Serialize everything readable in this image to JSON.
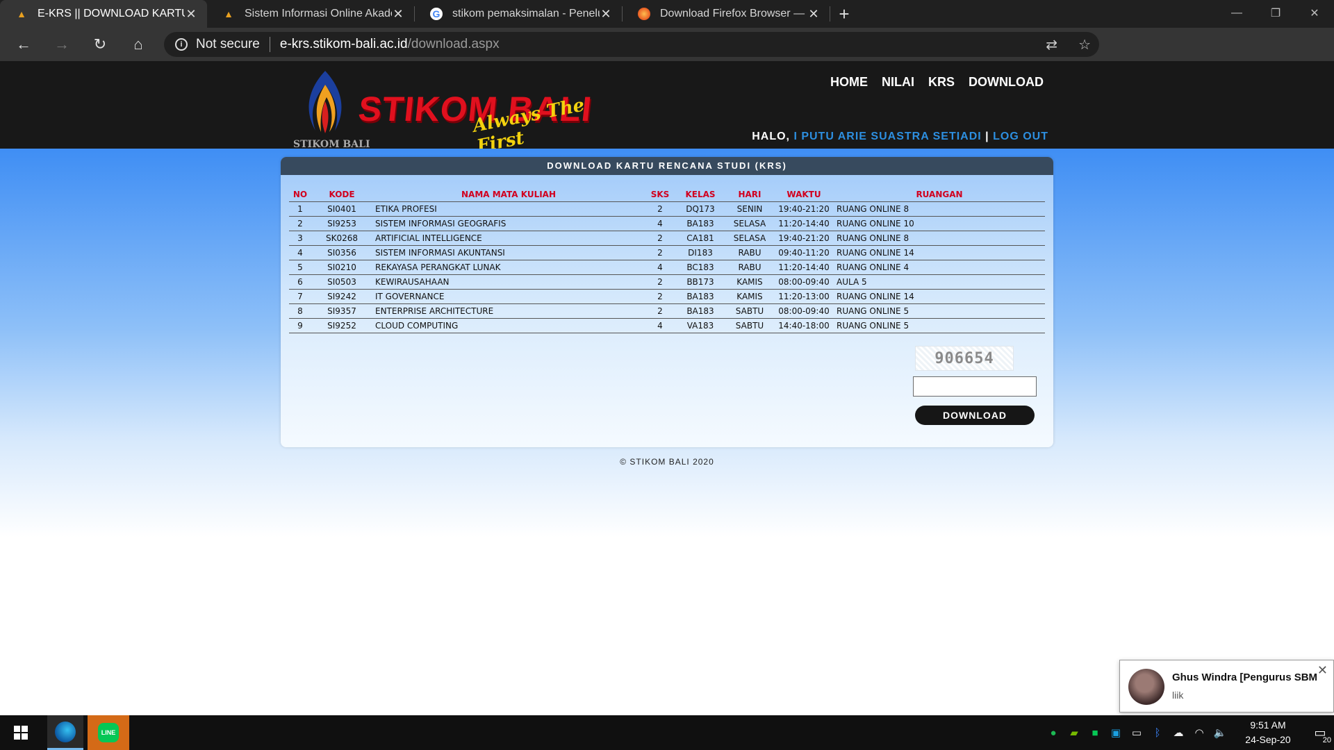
{
  "browser": {
    "tabs": [
      {
        "title": "E-KRS || DOWNLOAD KARTU RENCANA STUDI",
        "active": true
      },
      {
        "title": "Sistem Informasi Online Akademik",
        "active": false
      },
      {
        "title": "stikom pemaksimalan - Penelusuran Google",
        "active": false
      },
      {
        "title": "Download Firefox Browser — Fast, Private",
        "active": false
      }
    ],
    "security_label": "Not secure",
    "url_host": "e-krs.stikom-bali.ac.id",
    "url_path": "/download.aspx"
  },
  "site": {
    "logo_text": "STIKOM BALI",
    "logo_tagline": "Always The First",
    "logo_small": "STIKOM BALI",
    "nav": [
      "HOME",
      "NILAI",
      "KRS",
      "DOWNLOAD"
    ],
    "greeting_prefix": "HALO,",
    "user_name": "I PUTU ARIE SUASTRA SETIADI",
    "separator": "|",
    "logout_label": "LOG OUT"
  },
  "panel": {
    "title": "DOWNLOAD KARTU RENCANA STUDI (KRS)",
    "columns": [
      "NO",
      "KODE",
      "NAMA MATA KULIAH",
      "SKS",
      "KELAS",
      "HARI",
      "WAKTU",
      "RUANGAN"
    ],
    "rows": [
      [
        "1",
        "SI0401",
        "ETIKA PROFESI",
        "2",
        "DQ173",
        "SENIN",
        "19:40-21:20",
        "RUANG ONLINE 8"
      ],
      [
        "2",
        "SI9253",
        "SISTEM INFORMASI GEOGRAFIS",
        "4",
        "BA183",
        "SELASA",
        "11:20-14:40",
        "RUANG ONLINE 10"
      ],
      [
        "3",
        "SK0268",
        "ARTIFICIAL INTELLIGENCE",
        "2",
        "CA181",
        "SELASA",
        "19:40-21:20",
        "RUANG ONLINE 8"
      ],
      [
        "4",
        "SI0356",
        "SISTEM INFORMASI AKUNTANSI",
        "2",
        "DI183",
        "RABU",
        "09:40-11:20",
        "RUANG ONLINE 14"
      ],
      [
        "5",
        "SI0210",
        "REKAYASA PERANGKAT LUNAK",
        "4",
        "BC183",
        "RABU",
        "11:20-14:40",
        "RUANG ONLINE 4"
      ],
      [
        "6",
        "SI0503",
        "KEWIRAUSAHAAN",
        "2",
        "BB173",
        "KAMIS",
        "08:00-09:40",
        "AULA 5"
      ],
      [
        "7",
        "SI9242",
        "IT GOVERNANCE",
        "2",
        "BA183",
        "KAMIS",
        "11:20-13:00",
        "RUANG ONLINE 14"
      ],
      [
        "8",
        "SI9357",
        "ENTERPRISE ARCHITECTURE",
        "2",
        "BA183",
        "SABTU",
        "08:00-09:40",
        "RUANG ONLINE 5"
      ],
      [
        "9",
        "SI9252",
        "CLOUD COMPUTING",
        "4",
        "VA183",
        "SABTU",
        "14:40-18:00",
        "RUANG ONLINE 5"
      ]
    ],
    "captcha_code": "906654",
    "captcha_input_value": "",
    "download_label": "DOWNLOAD"
  },
  "footer": "© STIKOM BALI 2020",
  "notification": {
    "sender": "Ghus Windra [Pengurus SBM...",
    "message": "liik"
  },
  "taskbar": {
    "time": "9:51 AM",
    "date": "24-Sep-20",
    "notification_count": "20"
  },
  "colors": {
    "header_bg": "#181818",
    "table_header_red": "#d1001f",
    "link_blue": "#2d8fe0",
    "panel_head": "#374a5e"
  }
}
